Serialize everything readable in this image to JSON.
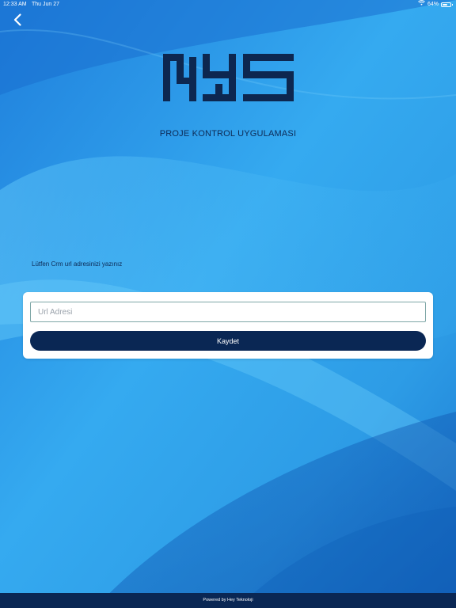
{
  "status_bar": {
    "time": "12:33 AM",
    "date": "Thu Jun 27",
    "battery_percent_label": "64%",
    "battery_level": 0.64,
    "wifi_icon": "wifi-icon",
    "battery_icon": "battery-icon"
  },
  "header": {
    "back_icon": "chevron-left-icon"
  },
  "logo": {
    "text": "NYS",
    "color": "#0d2750"
  },
  "app_title": "PROJE KONTROL UYGULAMASI",
  "form": {
    "prompt": "Lütfen Crm url adresinizi yazınız",
    "url_input": {
      "value": "",
      "placeholder": "Url Adresi"
    },
    "save_label": "Kaydet"
  },
  "footer": {
    "text": "Powered by Hey Teknoloji"
  },
  "colors": {
    "background": "#2f9fe8",
    "primary": "#0a2754",
    "card": "#ffffff"
  }
}
